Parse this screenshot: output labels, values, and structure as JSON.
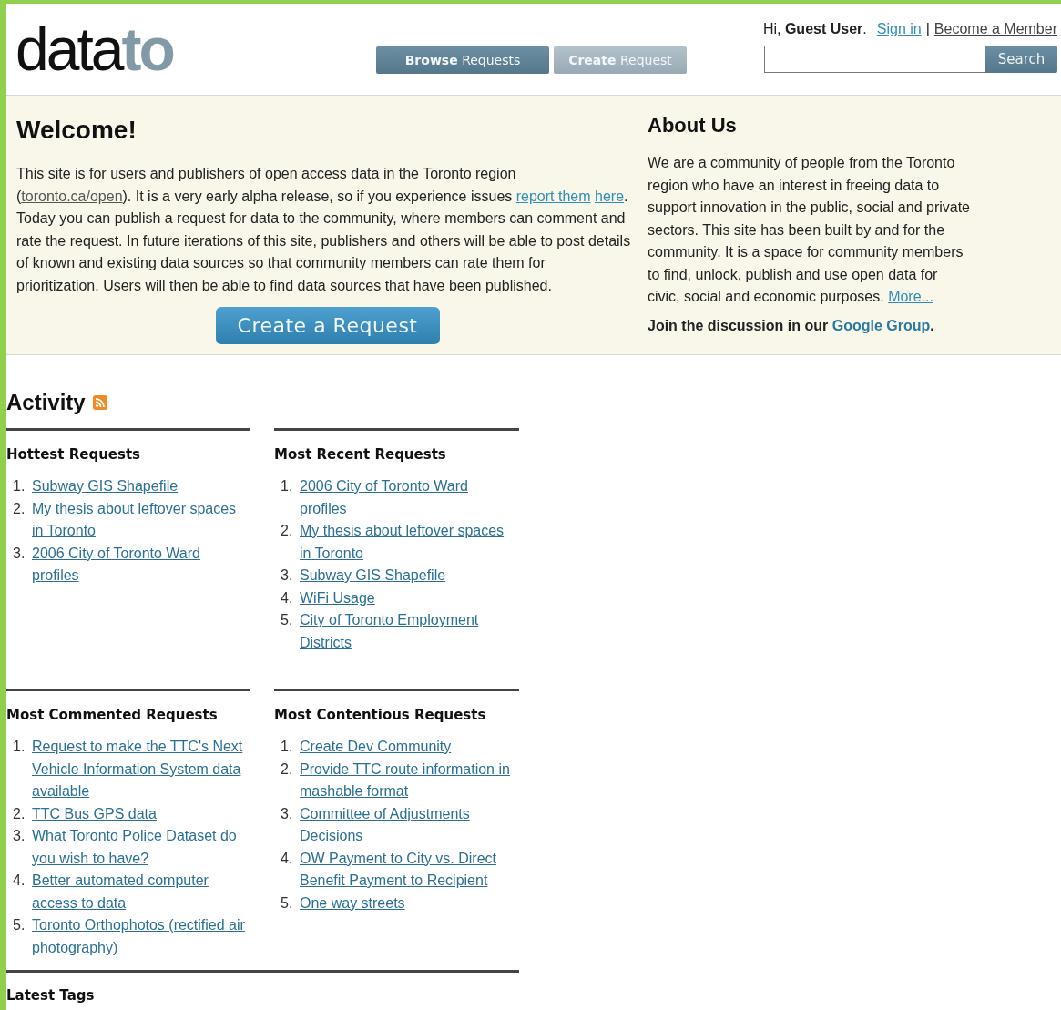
{
  "header": {
    "logo": {
      "dark": "data",
      "light": "to"
    },
    "nav": [
      {
        "bold": "Browse",
        "label": "Requests",
        "selected": true
      },
      {
        "bold": "Create",
        "label": "Request",
        "selected": false
      }
    ],
    "greeting": "Hi, **Guest User**.",
    "links": [
      {
        "label": "Sign in",
        "color": "#2f8fb5"
      },
      {
        "label": "Become a Member",
        "color": "#444444"
      }
    ],
    "separator": "|",
    "search": {
      "button": "Search"
    }
  },
  "welcome": {
    "title": "Welcome!",
    "paragraph": [
      {
        "kind": "text",
        "text": "This site is for users and publishers of open access data in the Toronto region ("
      },
      {
        "kind": "link",
        "text": "toronto.ca/open",
        "color": "#555555"
      },
      {
        "kind": "text",
        "text": "). It is a very early alpha release, so if you experience issues "
      },
      {
        "kind": "link",
        "text": "report them",
        "color": "#2f8fb5"
      },
      {
        "kind": "link",
        "text": "here",
        "color": "#2f8fb5"
      },
      {
        "kind": "text",
        "text": ". Today you can publish a request for data to the community, where members can comment and rate the request. In future iterations of this site, publishers and others will be able to post details of known and existing data sources so that community members can rate them for prioritization. Users will then be able to find data sources that have been published."
      }
    ],
    "button": "Create a Request"
  },
  "about": {
    "title": "About Us",
    "paragraph": [
      {
        "kind": "text",
        "text": "We are a community of people from the Toronto region who have an interest in freeing data to support innovation in the public, social and private sectors. This site has been built by and for the community. It is a space for community members to find, unlock, publish and use open data for civic, social and economic purposes. "
      },
      {
        "kind": "link",
        "text": "More...",
        "color": "#2f8fb5"
      }
    ],
    "join": [
      {
        "kind": "text",
        "text": "Join the discussion in our "
      },
      {
        "kind": "link",
        "text": "Google Group",
        "color": "#2a7aa0"
      },
      {
        "kind": "text",
        "text": "."
      }
    ]
  },
  "activity": {
    "title": "Activity",
    "lists": [
      {
        "title": "Hottest Requests",
        "items": [
          {
            "number": "1.",
            "label": "Subway GIS Shapefile"
          },
          {
            "number": "2.",
            "label": "My thesis about leftover spaces in Toronto"
          },
          {
            "number": "3.",
            "label": "2006 City of Toronto Ward profiles"
          }
        ]
      },
      {
        "title": "Most Recent Requests",
        "items": [
          {
            "number": "1.",
            "label": "2006 City of Toronto Ward profiles"
          },
          {
            "number": "2.",
            "label": "My thesis about leftover spaces in Toronto"
          },
          {
            "number": "3.",
            "label": "Subway GIS Shapefile"
          },
          {
            "number": "4.",
            "label": "WiFi Usage"
          },
          {
            "number": "5.",
            "label": "City of Toronto Employment Districts"
          }
        ]
      },
      {
        "title": "Most Commented Requests",
        "items": [
          {
            "number": "1.",
            "label": "Request to make the TTC's Next Vehicle Information System data available"
          },
          {
            "number": "2.",
            "label": "TTC Bus GPS data"
          },
          {
            "number": "3.",
            "label": "What Toronto Police Dataset do you wish to have?"
          },
          {
            "number": "4.",
            "label": "Better automated computer access to data"
          },
          {
            "number": "5.",
            "label": "Toronto Orthophotos (rectified air photography)"
          }
        ]
      },
      {
        "title": "Most Contentious Requests",
        "items": [
          {
            "number": "1.",
            "label": "Create Dev Community"
          },
          {
            "number": "2.",
            "label": "Provide TTC route information in mashable format"
          },
          {
            "number": "3.",
            "label": "Committee of Adjustments Decisions"
          },
          {
            "number": "4.",
            "label": "OW Payment to City vs. Direct Benefit Payment to Recipient"
          },
          {
            "number": "5.",
            "label": "One way streets"
          }
        ]
      }
    ]
  },
  "latest_tags": {
    "title": "Latest Tags"
  }
}
